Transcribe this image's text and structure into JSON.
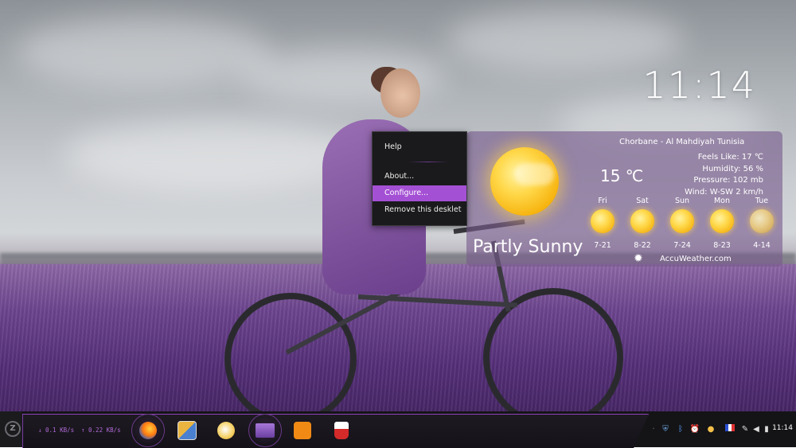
{
  "desktop": {
    "clock_time": "11:14"
  },
  "context_menu": {
    "items": [
      {
        "label": "Help"
      },
      {
        "label": "About..."
      },
      {
        "label": "Configure..."
      },
      {
        "label": "Remove this desklet"
      }
    ],
    "active_item": "Configure..."
  },
  "weather": {
    "location": "Chorbane - Al Mahdiyah Tunisia",
    "temperature": "15 ℃",
    "feels_like": "Feels Like: 17 ℃",
    "humidity": "Humidity: 56 %",
    "pressure": "Pressure: 102 mb",
    "wind": "Wind: W-SW 2 km/h",
    "condition": "Partly Sunny",
    "source": "AccuWeather.com",
    "current_icon": "partly-sunny-icon",
    "forecast": [
      {
        "day": "Fri",
        "range": "7-21",
        "icon": "sunny-icon"
      },
      {
        "day": "Sat",
        "range": "8-22",
        "icon": "sunny-icon"
      },
      {
        "day": "Sun",
        "range": "7-24",
        "icon": "sunny-icon"
      },
      {
        "day": "Mon",
        "range": "8-23",
        "icon": "sunny-icon"
      },
      {
        "day": "Tue",
        "range": "4-14",
        "icon": "hazy-sun-icon"
      }
    ]
  },
  "panel": {
    "net_down": "↓ 0.1 KB/s",
    "net_up": "↑ 0.22 KB/s",
    "launchers": [
      {
        "name": "firefox",
        "icon": "firefox-icon"
      },
      {
        "name": "libreoffice",
        "icon": "office-icon"
      },
      {
        "name": "weather",
        "icon": "weather-app-icon"
      },
      {
        "name": "files",
        "icon": "folder-icon"
      },
      {
        "name": "feed-reader",
        "icon": "rss-icon"
      },
      {
        "name": "popcorn",
        "icon": "popcorn-icon"
      }
    ],
    "tray_time": "11:14",
    "accent_color": "#a450d4"
  }
}
